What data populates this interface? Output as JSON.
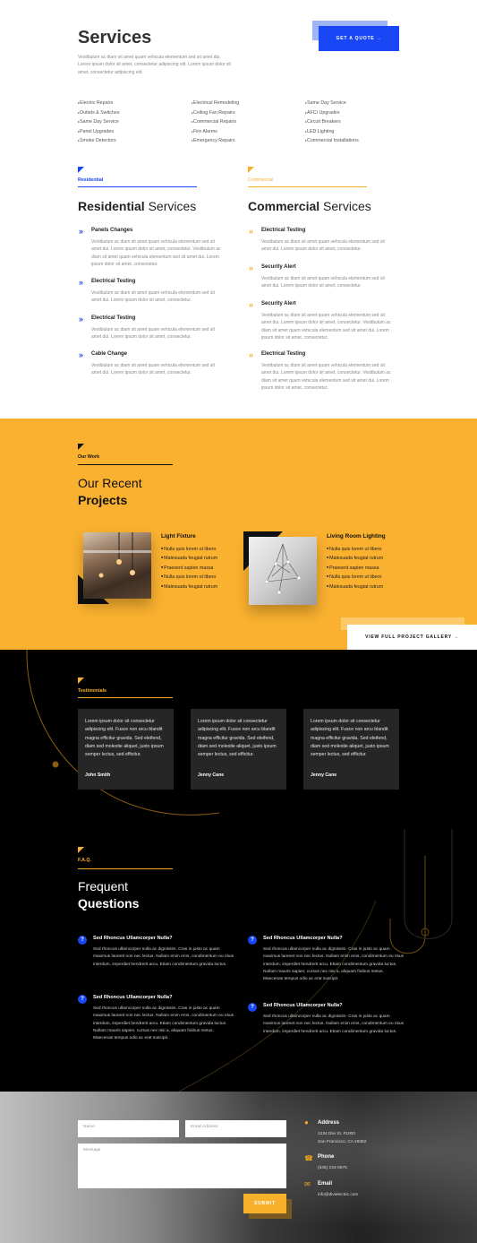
{
  "services": {
    "title": "Services",
    "description": "Vestibulum ac diam sit amet quam vehicula elementum sed sit amet dui. Lorem ipsum dolor sit amet, consectetur adipiscing elit. Lorem ipsum dolor sit amet, consectetur adipiscing elit.",
    "quote_button": "GET A QUOTE →",
    "columns": [
      [
        "Electric Repairs",
        "Outlets & Switches",
        "Same Day Service",
        "Panel Upgrades",
        "Smoke Detectors"
      ],
      [
        "Electrical Remodeling",
        "Ceiling Fan Repairs",
        "Commercial Repairs",
        "Fire Alarms",
        "Emergency Repairs"
      ],
      [
        "Same Day Service",
        "AFCI Upgrades",
        "Circuit Breakers",
        "LED Lighting",
        "Commercial Installations"
      ]
    ]
  },
  "residential": {
    "tag": "Residential",
    "heading_bold": "Residential",
    "heading_light": " Services",
    "items": [
      {
        "title": "Panels Changes",
        "desc": "Vestibulum ac diam sit amet quam vehicula elementum sed sit amet dui. Lorem ipsum dolor sit amet, consectetur. Vestibulum ac diam sit amet quam vehicula elementum sed sit amet dui. Lorem ipsum dolor sit amet, consectetur."
      },
      {
        "title": "Electrical Testing",
        "desc": "Vestibulum ac diam sit amet quam vehicula elementum sed sit amet dui. Lorem ipsum dolor sit amet, consectetur."
      },
      {
        "title": "Electrical Testing",
        "desc": "Vestibulum ac diam sit amet quam vehicula elementum sed sit amet dui. Lorem ipsum dolor sit amet, consectetur."
      },
      {
        "title": "Cable Change",
        "desc": "Vestibulum ac diam sit amet quam vehicula elementum sed sit amet dui. Lorem ipsum dolor sit amet, consectetur."
      }
    ]
  },
  "commercial": {
    "tag": "Commercial",
    "heading_bold": "Commercial",
    "heading_light": " Services",
    "items": [
      {
        "title": "Electrical Testing",
        "desc": "Vestibulum ac diam sit amet quam vehicula elementum sed sit amet dui. Lorem ipsum dolor sit amet, consectetur."
      },
      {
        "title": "Security Alert",
        "desc": "Vestibulum ac diam sit amet quam vehicula elementum sed sit amet dui. Lorem ipsum dolor sit amet, consectetur."
      },
      {
        "title": "Security Alert",
        "desc": "Vestibulum ac diam sit amet quam vehicula elementum sed sit amet dui. Lorem ipsum dolor sit amet, consectetur. Vestibulum ac diam sit amet quam vehicula elementum sed sit amet dui. Lorem ipsum dolor sit amet, consectetur."
      },
      {
        "title": "Electrical Testing",
        "desc": "Vestibulum ac diam sit amet quam vehicula elementum sed sit amet dui. Lorem ipsum dolor sit amet, consectetur. Vestibulum ac diam sit amet quam vehicula elementum sed sit amet dui. Lorem ipsum dolor sit amet, consectetur."
      }
    ]
  },
  "projects": {
    "tag": "Our Work",
    "heading_light": "Our Recent",
    "heading_bold": "Projects",
    "cards": [
      {
        "title": "Light Fixture",
        "bullets": [
          "Nulla quis lorem ut libero",
          "Malesuada feugiat rutrum",
          "Praesent sapien massa",
          "Nulla quis lorem ut libero",
          "Malesuada feugiat rutrum"
        ]
      },
      {
        "title": "Living Room Lighting",
        "bullets": [
          "Nulla quis lorem ut libero",
          "Malesuada feugiat rutrum",
          "Praesent sapien massa",
          "Nulla quis lorem ut libero",
          "Malesuada feugiat rutrum"
        ]
      }
    ],
    "gallery_button": "VIEW FULL PROJECT GALLERY →"
  },
  "testimonials": {
    "tag": "Testimonials",
    "cards": [
      {
        "text": "Lorem ipsum dolor sit consectetur adipiscing elit. Fusce non arcu blandit magna efficitur gravida. Sed eleifend, diam sed molestie aliquet, justo ipsum semper lectus, sed efficitur.",
        "name": "John Smith"
      },
      {
        "text": "Lorem ipsum dolor sit consectetur adipiscing elit. Fusce non arcu blandit magna efficitur gravida. Sed eleifend, diam sed molestie aliquet, justo ipsum semper lectus, sed efficitur.",
        "name": "Jenny Cane"
      },
      {
        "text": "Lorem ipsum dolor sit consectetur adipiscing elit. Fusce non arcu blandit magna efficitur gravida. Sed eleifend, diam sed molestie aliquet, justo ipsum semper lectus, sed efficitur.",
        "name": "Jenny Cane"
      }
    ]
  },
  "faq": {
    "tag": "F.A.Q.",
    "heading_light": "Frequent",
    "heading_bold": "Questions",
    "items": [
      {
        "q": "Sed Rhoncus Ullamcorper Nulla?",
        "a": "Sed rhoncus ullamcorper nulla ac dignissim. Cras in justo ac quam maximus laoreet non nec lectus. Nullam enim eros, condimentum eu risus interdum, imperdiet hendrerit arcu. Etiam condimentum gravida luctus."
      },
      {
        "q": "Sed Rhoncus Ullamcorper Nulla?",
        "a": "Sed rhoncus ullamcorper nulla ac dignissim. Cras in justo ac quam maximus laoreet non nec lectus. Nullam enim eros, condimentum eu risus interdum, imperdiet hendrerit arcu. Etiam condimentum gravida luctus. Nullam mauris sapien, cursus nec nisi a, aliquam finibus metus. Maecenas tempus odio ac erat suscipit."
      },
      {
        "q": "Sed Rhoncus Ullamcorper Nulla?",
        "a": "Sed rhoncus ullamcorper nulla ac dignissim. Cras in justo ac quam maximus laoreet non nec lectus. Nullam enim eros, condimentum eu risus interdum, imperdiet hendrerit arcu. Etiam condimentum gravida luctus. Nullam mauris sapien, cursus nec nisi a, aliquam finibus metus. Maecenas tempus odio ac erat suscipit."
      },
      {
        "q": "Sed Rhoncus Ullamcorper Nulla?",
        "a": "Sed rhoncus ullamcorper nulla ac dignissim. Cras in justo ac quam maximus laoreet non nec lectus. Nullam enim eros, condimentum eu risus interdum, imperdiet hendrerit arcu. Etiam condimentum gravida luctus."
      }
    ]
  },
  "contact": {
    "name_placeholder": "Name",
    "email_placeholder": "Email Address",
    "message_placeholder": "Message",
    "submit": "SUBMIT",
    "address_label": "Address",
    "address_line1": "1234 Divi St. #1000",
    "address_line2": "San Francisco, CA 29382",
    "phone_label": "Phone",
    "phone": "(346) 234-5675",
    "email_label": "Email",
    "email": "info@divielectric.com"
  },
  "colors": {
    "accent_blue": "#1a47f5",
    "accent_yellow": "#f7b02c",
    "dark": "#000000"
  }
}
